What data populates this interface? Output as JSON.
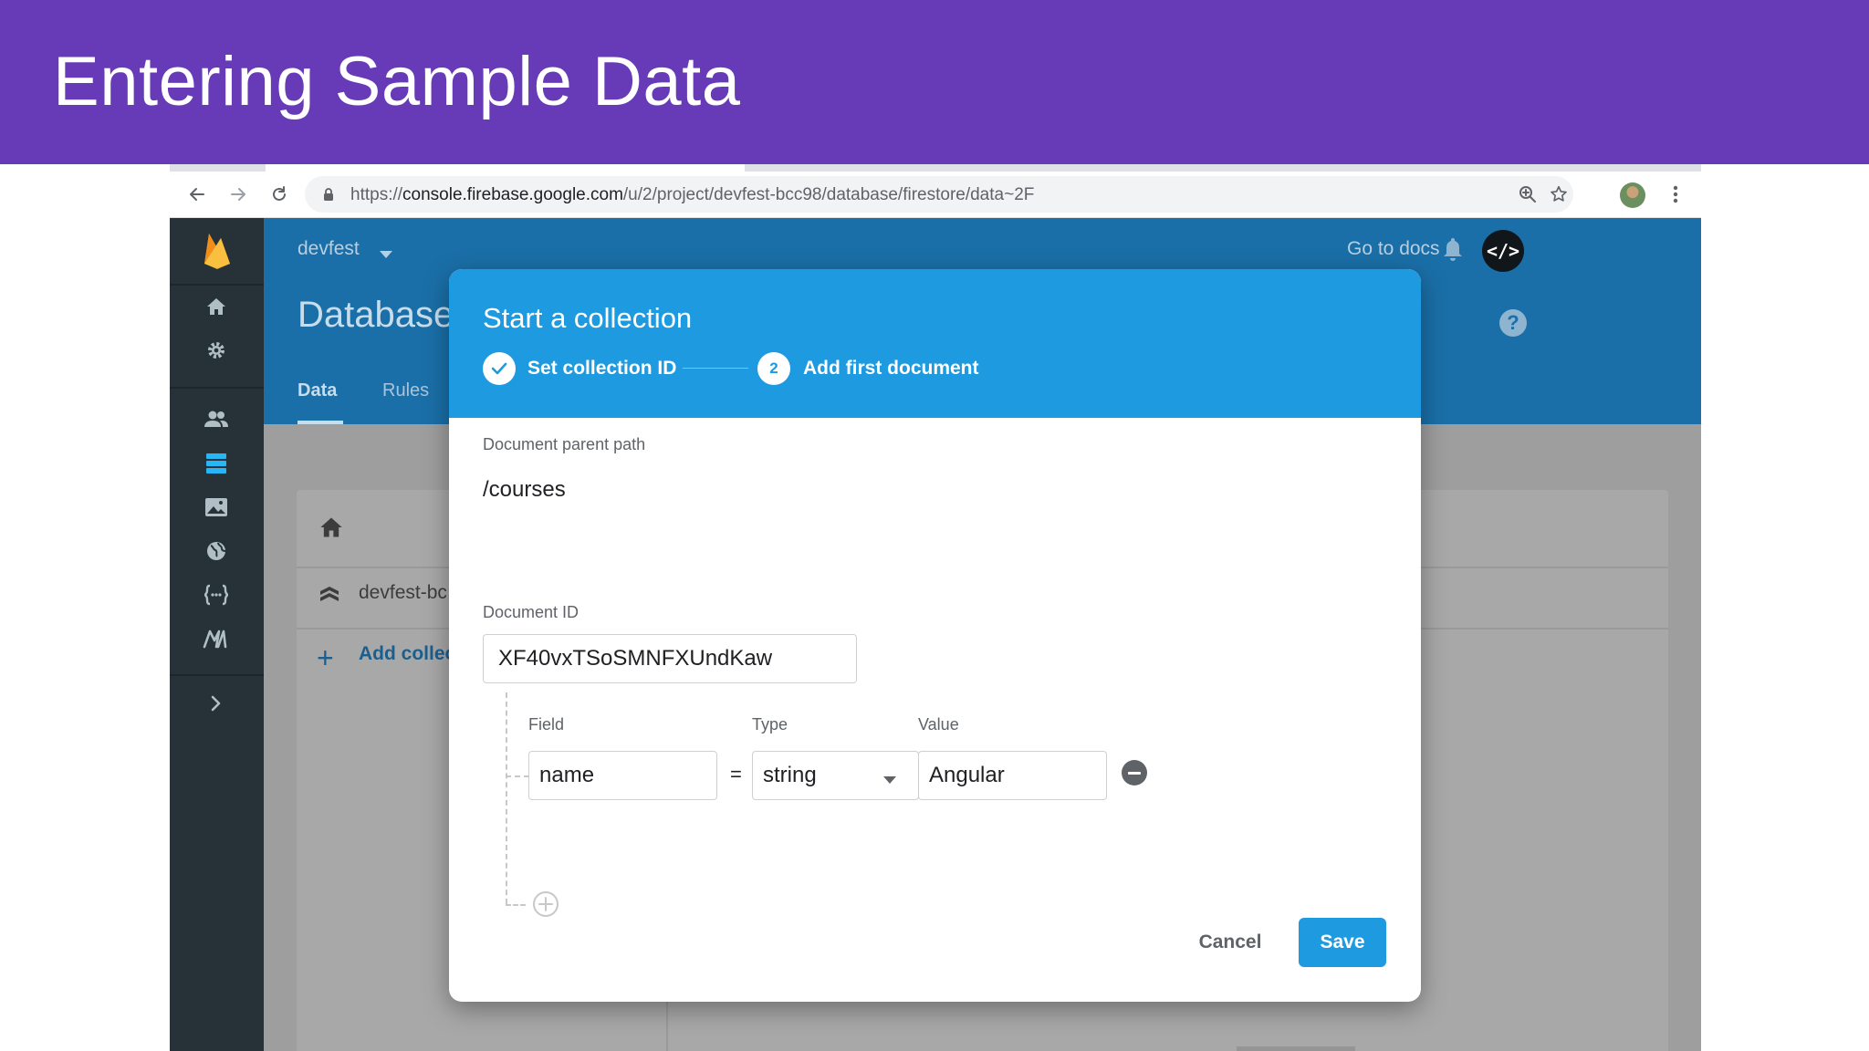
{
  "slide": {
    "title": "Entering Sample Data"
  },
  "browser": {
    "url_scheme": "https://",
    "url_host": "console.firebase.google.com",
    "url_path": "/u/2/project/devfest-bcc98/database/firestore/data~2F"
  },
  "console": {
    "project_name": "devfest",
    "go_to_docs": "Go to docs",
    "code_button": "</>",
    "page_title": "Database",
    "help": "?",
    "tabs": [
      {
        "label": "Data"
      },
      {
        "label": "Rules"
      }
    ],
    "panel": {
      "project_id": "devfest-bc",
      "add_collection": "Add collec"
    },
    "sidebar_icons": [
      "home-icon",
      "settings-icon",
      "users-icon",
      "database-icon",
      "storage-icon",
      "hosting-icon",
      "functions-icon",
      "ml-kit-icon",
      "expand-icon"
    ]
  },
  "dialog": {
    "title": "Start a collection",
    "steps": [
      {
        "label": "Set collection ID",
        "state": "done"
      },
      {
        "number": "2",
        "label": "Add first document",
        "state": "active"
      }
    ],
    "parent_path_label": "Document parent path",
    "parent_path_value": "/courses",
    "document_id_label": "Document ID",
    "document_id_value": "XF40vxTSoSMNFXUndKaw",
    "field_headers": {
      "field": "Field",
      "type": "Type",
      "value": "Value"
    },
    "field_row": {
      "field": "name",
      "equals": "=",
      "type": "string",
      "value": "Angular"
    },
    "cancel_label": "Cancel",
    "save_label": "Save"
  },
  "colors": {
    "slide_header": "#673ab7",
    "dialog_accent": "#1e9ae0",
    "console_header": "#1a6fa8",
    "sidebar": "#263238"
  }
}
